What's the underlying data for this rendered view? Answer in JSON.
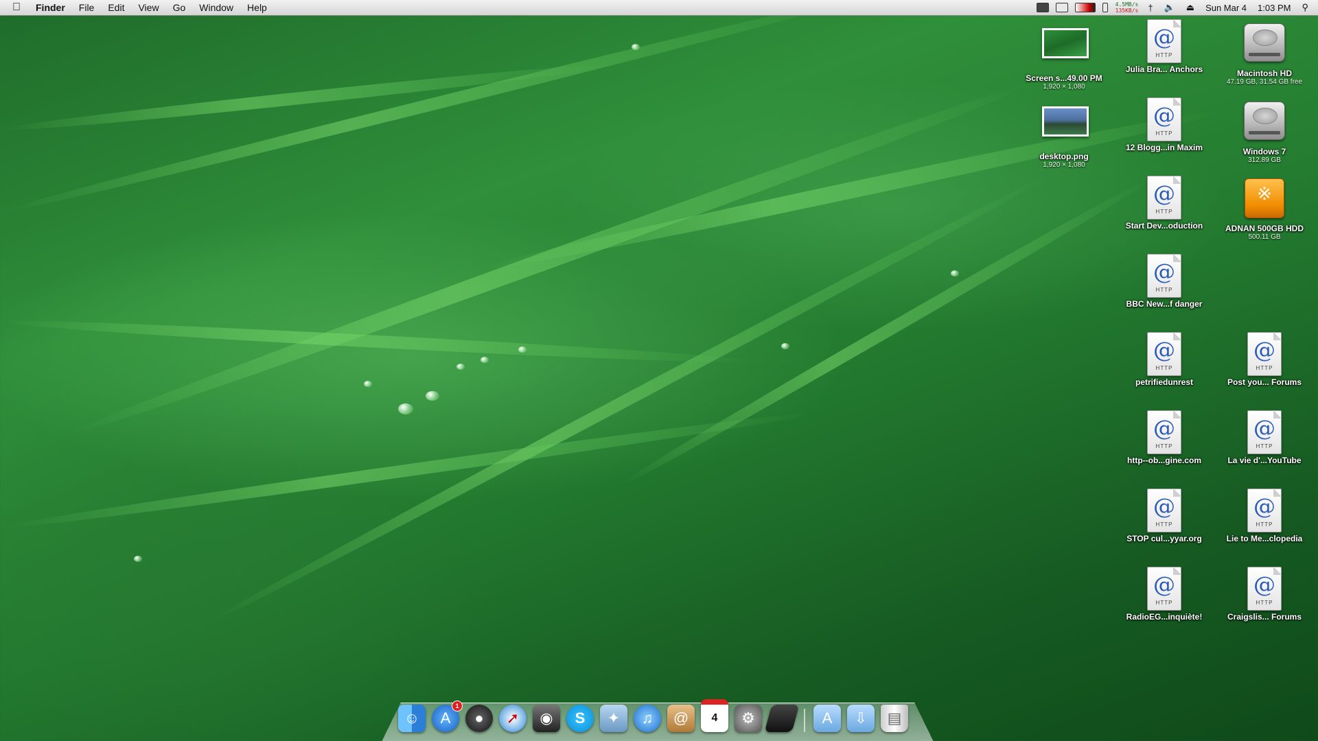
{
  "menubar": {
    "apple": "",
    "app": "Finder",
    "items": [
      "File",
      "Edit",
      "View",
      "Go",
      "Window",
      "Help"
    ],
    "net_up": "4.5MB/s",
    "net_down": "135KB/s",
    "date": "Sun Mar 4",
    "time": "1:03 PM"
  },
  "desktop": {
    "icons": [
      {
        "label": "Screen s...49.00 PM",
        "sub": "1,920 × 1,080",
        "kind": "screenshot"
      },
      {
        "label": "Julia Bra... Anchors",
        "sub": "",
        "kind": "http"
      },
      {
        "label": "Macintosh HD",
        "sub": "47.19 GB, 31.54 GB free",
        "kind": "hdd"
      },
      {
        "label": "desktop.png",
        "sub": "1,920 × 1,080",
        "kind": "image"
      },
      {
        "label": "12 Blogg...in Maxim",
        "sub": "",
        "kind": "http"
      },
      {
        "label": "Windows 7",
        "sub": "312.89 GB",
        "kind": "hdd"
      },
      {
        "label": "Start Dev...oduction",
        "sub": "",
        "kind": "http"
      },
      {
        "label": "ADNAN 500GB HDD",
        "sub": "500.11 GB",
        "kind": "usb"
      },
      {
        "label": "BBC New...f danger",
        "sub": "",
        "kind": "http"
      },
      {
        "label": "petrifiedunrest",
        "sub": "",
        "kind": "http"
      },
      {
        "label": "Post you... Forums",
        "sub": "",
        "kind": "http"
      },
      {
        "label": "http--ob...gine.com",
        "sub": "",
        "kind": "http"
      },
      {
        "label": "La vie d'...YouTube",
        "sub": "",
        "kind": "http"
      },
      {
        "label": "STOP cul...yyar.org",
        "sub": "",
        "kind": "http"
      },
      {
        "label": "Lie to Me...clopedia",
        "sub": "",
        "kind": "http"
      },
      {
        "label": "RadioEG...inquiète!",
        "sub": "",
        "kind": "http"
      },
      {
        "label": "Craigslis... Forums",
        "sub": "",
        "kind": "http"
      }
    ]
  },
  "dock": {
    "app_store_badge": "1",
    "calendar_day": "4",
    "http_text": "HTTP",
    "at": "@"
  },
  "colors": {
    "menubar": "#e4e4e4",
    "grass": "#2f8f3a",
    "badge": "#e02020",
    "link": "#2a5ab8"
  }
}
